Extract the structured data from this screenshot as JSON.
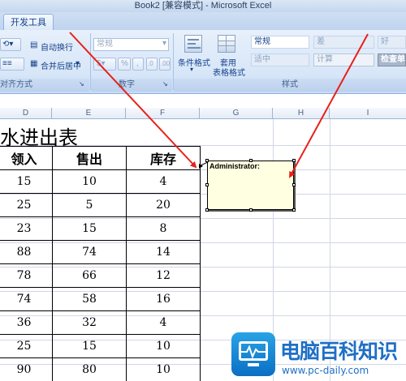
{
  "window": {
    "title": "Book2  [兼容模式] - Microsoft Excel"
  },
  "ribbon": {
    "active_tab": "开发工具",
    "alignment": {
      "wrap_text": "自动换行",
      "merge_center": "合并后居中",
      "group_label": "对齐方式"
    },
    "number": {
      "format_value": "常规",
      "group_label": "数字"
    },
    "styles": {
      "conditional_format": "条件格式",
      "format_as_table_1": "套用",
      "format_as_table_2": "表格格式",
      "cell_styles": {
        "normal": "常规",
        "bad": "差",
        "good": "好",
        "neutral": "适中",
        "calculation": "计算",
        "check_cell": "检查单"
      },
      "group_label": "样式"
    }
  },
  "columns": [
    "D",
    "E",
    "F",
    "G",
    "H",
    "I"
  ],
  "sheet": {
    "title": "水进出表",
    "headers": [
      "领入",
      "售出",
      "库存"
    ],
    "rows": [
      [
        "15",
        "10",
        "4"
      ],
      [
        "25",
        "5",
        "20"
      ],
      [
        "23",
        "15",
        "8"
      ],
      [
        "88",
        "74",
        "14"
      ],
      [
        "78",
        "66",
        "12"
      ],
      [
        "74",
        "58",
        "16"
      ],
      [
        "36",
        "32",
        "4"
      ],
      [
        "25",
        "15",
        "10"
      ],
      [
        "90",
        "80",
        "10"
      ]
    ]
  },
  "comment": {
    "author": "Administrator:"
  },
  "colors": {
    "arrow": "#e8201a",
    "ribbon_text": "#15428b",
    "comment_bg": "#ffffe1"
  },
  "watermark": {
    "text": "电脑百科知识",
    "url": "www.pc-daily.com"
  }
}
